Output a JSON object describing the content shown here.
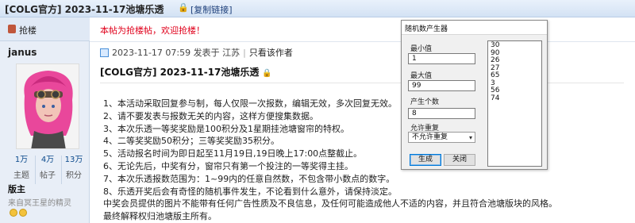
{
  "thread": {
    "title": "[COLG官方] 2023-11-17池塘乐透",
    "copy_link": "[复制链接]"
  },
  "floor": {
    "label": "抢楼"
  },
  "user": {
    "name": "janus",
    "stats": [
      {
        "value": "1万",
        "label": "主题"
      },
      {
        "value": "4万",
        "label": "帖子"
      },
      {
        "value": "13万",
        "label": "积分"
      }
    ],
    "role": "版主",
    "signature": "来自冥王星的精灵"
  },
  "post": {
    "notice": "本帖为抢楼帖，欢迎抢楼！",
    "meta": {
      "datetime": "2023-11-17 07:59",
      "location_prefix": "发表于",
      "location": "江苏",
      "author_only": "只看该作者"
    },
    "title": "[COLG官方] 2023-11-17池塘乐透",
    "lines": [
      "1、本活动采取回复参与制，每人仅限一次报数，编辑无效，多次回复无效。",
      "2、请不要发表与报数无关的内容，这样方便搜集数据。",
      "3、本次乐透一等奖奖励是100积分及1星期挂池塘窗帘的特权。",
      "4、二等奖奖励50积分；三等奖奖励35积分。",
      "5、活动报名时间为即日起至11月19日,19日晚上17:00点整截止。",
      "6、无论先后，中奖有分，窗帘只有第一个投注的一等奖得主挂。",
      "7、本次乐透报数范围为：1~99内的任意自然数，不包含带小数点的数字。",
      "8、乐透开奖后会有奇怪的随机事件发生，不论看到什么意外，请保持淡定。",
      "中奖会员提供的图片不能带有任何广告性质及不良信息，及任何可能造成他人不适的内容，并且符合池塘版块的风格。",
      "最终解释权归池塘版主所有。"
    ]
  },
  "dialog": {
    "title": "随机数产生器",
    "min_label": "最小值",
    "min_value": "1",
    "max_label": "最大值",
    "max_value": "99",
    "count_label": "产生个数",
    "count_value": "8",
    "repeat_label": "允许重复",
    "repeat_selected": "不允许重复",
    "generate_label": "生成",
    "close_label": "关闭",
    "results": [
      "30",
      "90",
      "26",
      "27",
      "65",
      "3",
      "56",
      "74"
    ]
  },
  "colors": {
    "notice_red": "#e0001b",
    "link_blue": "#1d3f7a",
    "stat_blue": "#0b4a8c",
    "titlebar_bg": "#d3e2f4"
  },
  "icons": [
    "lock-icon",
    "floor-icon",
    "post-meta-icon",
    "smiley-icon",
    "select-arrow-icon"
  ]
}
